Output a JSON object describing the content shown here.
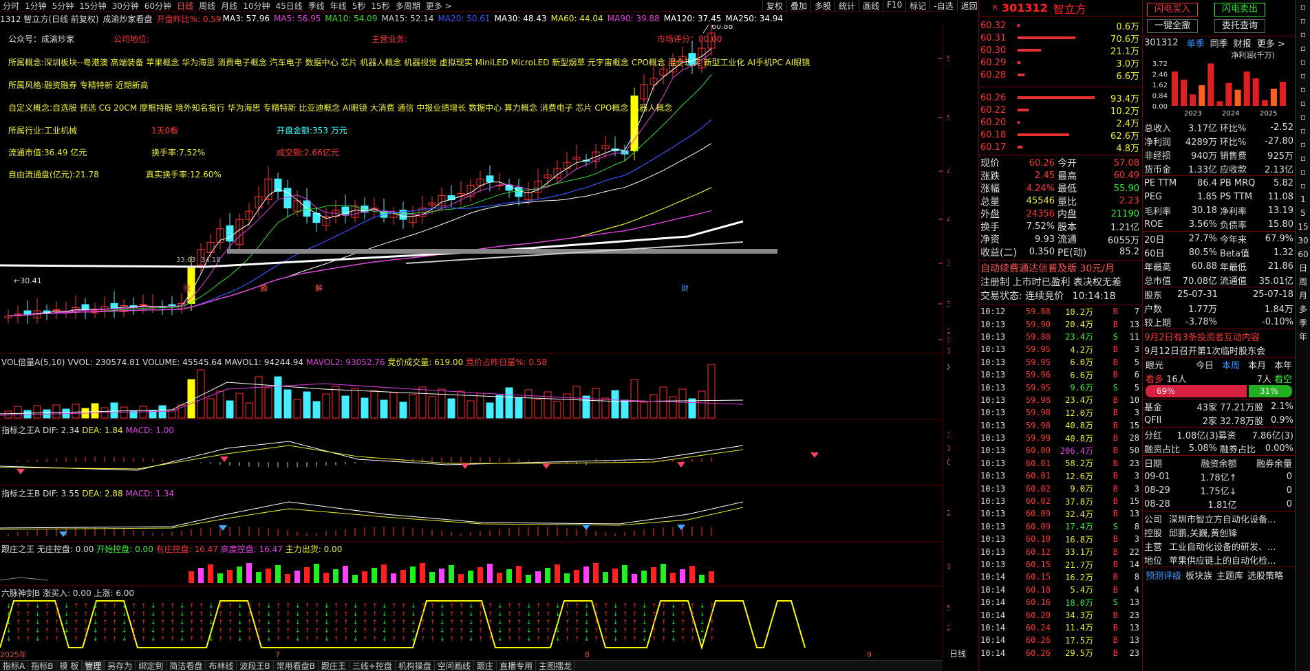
{
  "period_tabs": [
    "分时",
    "1分钟",
    "5分钟",
    "15分钟",
    "30分钟",
    "60分钟",
    "日线",
    "周线",
    "月线",
    "10分钟",
    "45日线",
    "季线",
    "年线",
    "5秒",
    "15秒",
    "多周期",
    "更多 >"
  ],
  "period_selected": "日线",
  "toolbar": [
    "复权",
    "叠加",
    "多股",
    "统计",
    "画线",
    "F10",
    "标记",
    "-自选",
    "返回"
  ],
  "ma_bar": {
    "title": "1312 智立方(日线 前复权)",
    "indicator": "成渝炒家看盘",
    "open_pct_label": "开盘昨比%:",
    "open_pct": "0.59",
    "ma": [
      {
        "label": "MA3: 57.96",
        "color": "#ffffff"
      },
      {
        "label": "MA5: 56.95",
        "color": "#e040e0"
      },
      {
        "label": "MA10: 54.09",
        "color": "#33dd33"
      },
      {
        "label": "MA15: 52.14",
        "color": "#cccccc"
      },
      {
        "label": "MA20: 50.61",
        "color": "#3355ff"
      },
      {
        "label": "MA30: 48.43",
        "color": "#ffffff"
      },
      {
        "label": "MA60: 44.04",
        "color": "#eeee33"
      },
      {
        "label": "MA90: 39.88",
        "color": "#e040e0"
      },
      {
        "label": "MA120: 37.45",
        "color": "#ffffff"
      },
      {
        "label": "MA250: 34.94",
        "color": "#ffffff"
      }
    ]
  },
  "info": {
    "gongzhonghao": "公众号：成渝炒家",
    "company_pos": "公司地位:",
    "main_biz": "主营业务:",
    "market_score": "市场评分：80.00",
    "concepts": "所属概念:深圳板块--粤港澳 高端装备 苹果概念 华为海思 消费电子概念 汽车电子 数据中心 芯片 机器人概念 机器视觉 虚拟现实 MiniLED MicroLED 新型烟草 元宇宙概念 CPO概念 混合现实 新型工业化 AI手机PC AI眼镜",
    "styles": "所属风格:融资融券 专精特新 近期新高",
    "custom": "自定义概念:自选股 预选 CG 20CM 摩根持股 境外知名投行 华为海思 专精特新 比亚迪概念 AI眼镜 大消费 通信 中报业绩增长 数据中心 算力概念 消费电子 芯片 CPO概念 机器人概念",
    "industry": "所属行业:工业机械",
    "board": "1天0板",
    "open_amount": "开盘金额:353 万元",
    "float_cap": "流通市值:36.49 亿元",
    "turnover": "换手率:7.52%",
    "volume_amt": "成交额:2.66亿元",
    "free_float": "自由流通盘(亿元):21.78",
    "real_turnover": "真实换手率:12.60%"
  },
  "kline": {
    "y_ticks": [
      "57.81",
      "52.03",
      "46.83",
      "42.14",
      "37.93",
      "34.14",
      "30.72"
    ],
    "high_label": "60.88",
    "low_label": "30.41",
    "mid_label": "33.63",
    "mid_label2": "34.18",
    "markers": [
      "涨",
      "腾",
      "解",
      "财"
    ],
    "months": [
      "2025年",
      "7",
      "8",
      "9"
    ]
  },
  "vol_panel": {
    "title": "VOL倍量A(5,10)",
    "vvol": "VVOL: 230574.81",
    "volume": "VOLUME: 45545.64",
    "mavol1": "MAVOL1: 94244.94",
    "mavol2": "MAVOL2: 93052.76",
    "bid_vol": "竞价成交量: 619.00",
    "bid_ratio": "竞价占昨日量%: 0.58",
    "y_ticks": [
      "20000",
      "10000",
      "X10"
    ]
  },
  "macd_a": {
    "title": "指标之王A",
    "dif": "DIF: 2.34",
    "dea": "DEA: 1.84",
    "macd": "MACD: 1.00",
    "y_ticks": [
      "3.00",
      "1.50",
      "0.00"
    ]
  },
  "macd_b": {
    "title": "指标之王B",
    "dif": "DIF: 3.55",
    "dea": "DEA: 2.88",
    "macd": "MACD: 1.34",
    "y_ticks": [
      "2.00"
    ]
  },
  "zhuang": {
    "title": "跟庄之王",
    "wz": "无庄控盘: 0.00",
    "ks": "开始控盘: 0.00",
    "yz": "有庄控盘: 16.47",
    "gd": "高度控盘: 16.47",
    "zl": "主力出货: 0.00",
    "y_ticks": [
      "15.00"
    ]
  },
  "liumai": {
    "title": "六脉神剑B",
    "buy": "涨买入: 0.00",
    "up": "上涨: 6.00",
    "y_ticks": [
      "5.00",
      "2.50"
    ]
  },
  "bottom_tabs": [
    "指标A",
    "指标B",
    "模 板",
    "管理",
    "另存为",
    "绑定到",
    "简洁看盘",
    "布林线",
    "波段王B",
    "常用看盘B",
    "跟庄王",
    "三线+控盘",
    "机构操盘",
    "空间画线",
    "跟庄",
    "直播专用",
    "主图擂龙"
  ],
  "bottom_selected": "管理",
  "bottom_right": "日线",
  "stock": {
    "code": "301312",
    "name": "智立方",
    "r_mark": "R"
  },
  "asks": [
    {
      "p": "60.32",
      "v": "0.6万",
      "w": 0.02
    },
    {
      "p": "60.31",
      "v": "70.6万",
      "w": 0.75
    },
    {
      "p": "60.30",
      "v": "21.1万",
      "w": 0.3
    },
    {
      "p": "60.29",
      "v": "3.0万",
      "w": 0.04
    },
    {
      "p": "60.28",
      "v": "6.6万",
      "w": 0.09
    }
  ],
  "bids": [
    {
      "p": "60.26",
      "v": "93.4万",
      "w": 1.0
    },
    {
      "p": "60.22",
      "v": "10.2万",
      "w": 0.14
    },
    {
      "p": "60.20",
      "v": "2.4万",
      "w": 0.03
    },
    {
      "p": "60.18",
      "v": "62.6万",
      "w": 0.67
    },
    {
      "p": "60.17",
      "v": "4.8万",
      "w": 0.06
    }
  ],
  "quote": [
    {
      "l1": "现价",
      "v1": "60.26",
      "c1": "#ff3333",
      "l2": "今开",
      "v2": "57.08",
      "c2": "#ff3333"
    },
    {
      "l1": "涨跌",
      "v1": "2.45",
      "c1": "#ff3333",
      "l2": "最高",
      "v2": "60.49",
      "c2": "#ff3333"
    },
    {
      "l1": "涨幅",
      "v1": "4.24%",
      "c1": "#ff3333",
      "l2": "最低",
      "v2": "55.90",
      "c2": "#33ee33"
    },
    {
      "l1": "总量",
      "v1": "45546",
      "c1": "#eeee33",
      "l2": "量比",
      "v2": "2.23",
      "c2": "#ff3333"
    },
    {
      "l1": "外盘",
      "v1": "24356",
      "c1": "#ff3333",
      "l2": "内盘",
      "v2": "21190",
      "c2": "#33ee33"
    },
    {
      "l1": "换手",
      "v1": "7.52%",
      "c1": "#dddddd",
      "l2": "股本",
      "v2": "1.21亿",
      "c2": "#dddddd"
    },
    {
      "l1": "净资",
      "v1": "9.93",
      "c1": "#dddddd",
      "l2": "流通",
      "v2": "6055万",
      "c2": "#dddddd"
    },
    {
      "l1": "收益(二)",
      "v1": "0.350",
      "c1": "#dddddd",
      "l2": "PE(动)",
      "v2": "85.2",
      "c2": "#dddddd"
    }
  ],
  "notice": {
    "line1": "自动续费通达信普及版  30元/月",
    "line2": "注册制 上市时已盈利 表决权无差",
    "line3": "交易状态: 连续竞价",
    "time": "10:14:18"
  },
  "ticks": [
    {
      "t": "10:12",
      "p": "59.88",
      "v": "10.2万",
      "s": "B",
      "n": "7"
    },
    {
      "t": "10:13",
      "p": "59.90",
      "v": "20.4万",
      "s": "B",
      "n": "13"
    },
    {
      "t": "10:13",
      "p": "59.88",
      "v": "23.4万",
      "s": "S",
      "n": "11"
    },
    {
      "t": "10:13",
      "p": "59.95",
      "v": "4.2万",
      "s": "B",
      "n": "3"
    },
    {
      "t": "10:13",
      "p": "59.95",
      "v": "6.0万",
      "s": "B",
      "n": "5"
    },
    {
      "t": "10:13",
      "p": "59.96",
      "v": "6.6万",
      "s": "B",
      "n": "6"
    },
    {
      "t": "10:13",
      "p": "59.95",
      "v": "9.6万",
      "s": "S",
      "n": "5"
    },
    {
      "t": "10:13",
      "p": "59.98",
      "v": "23.4万",
      "s": "B",
      "n": "10"
    },
    {
      "t": "10:13",
      "p": "59.98",
      "v": "12.0万",
      "s": "B",
      "n": "3"
    },
    {
      "t": "10:13",
      "p": "59.98",
      "v": "40.8万",
      "s": "B",
      "n": "15"
    },
    {
      "t": "10:13",
      "p": "59.99",
      "v": "40.8万",
      "s": "B",
      "n": "28"
    },
    {
      "t": "10:13",
      "p": "60.00",
      "v": "206.4万",
      "s": "B",
      "n": "50"
    },
    {
      "t": "10:13",
      "p": "60.01",
      "v": "58.2万",
      "s": "B",
      "n": "23"
    },
    {
      "t": "10:13",
      "p": "60.01",
      "v": "12.6万",
      "s": "B",
      "n": "3"
    },
    {
      "t": "10:13",
      "p": "60.02",
      "v": "9.0万",
      "s": "B",
      "n": "3"
    },
    {
      "t": "10:13",
      "p": "60.02",
      "v": "37.8万",
      "s": "B",
      "n": "15"
    },
    {
      "t": "10:13",
      "p": "60.09",
      "v": "32.4万",
      "s": "B",
      "n": "13"
    },
    {
      "t": "10:13",
      "p": "60.09",
      "v": "17.4万",
      "s": "S",
      "n": "8"
    },
    {
      "t": "10:13",
      "p": "60.10",
      "v": "16.8万",
      "s": "B",
      "n": "3"
    },
    {
      "t": "10:13",
      "p": "60.12",
      "v": "33.1万",
      "s": "B",
      "n": "22"
    },
    {
      "t": "10:13",
      "p": "60.15",
      "v": "21.7万",
      "s": "B",
      "n": "14"
    },
    {
      "t": "10:14",
      "p": "60.15",
      "v": "16.2万",
      "s": "B",
      "n": "8"
    },
    {
      "t": "10:14",
      "p": "60.18",
      "v": "5.4万",
      "s": "B",
      "n": "4"
    },
    {
      "t": "10:14",
      "p": "60.16",
      "v": "18.0万",
      "s": "S",
      "n": "13"
    },
    {
      "t": "10:14",
      "p": "60.20",
      "v": "34.3万",
      "s": "B",
      "n": "23"
    },
    {
      "t": "10:14",
      "p": "60.24",
      "v": "11.4万",
      "s": "B",
      "n": "13"
    },
    {
      "t": "10:14",
      "p": "60.26",
      "v": "17.5万",
      "s": "B",
      "n": "13"
    },
    {
      "t": "10:14",
      "p": "60.26",
      "v": "29.5万",
      "s": "B",
      "n": "23"
    }
  ],
  "far": {
    "btn_sell": "闪电买入",
    "btn_buy": "闪电卖出",
    "btn_all": "一键全撤",
    "btn_query": "委托查询",
    "code": "301312",
    "tabs": [
      "单季",
      "同季",
      "财报",
      "更多 >"
    ],
    "chart_title": "净利润(千万)",
    "chart_data": {
      "type": "bar",
      "ylabels": [
        "3.72",
        "2.46",
        "1.62",
        "0.84",
        "0.00"
      ],
      "xlabels": [
        "2023",
        "2024",
        "2025"
      ],
      "values": [
        3.0,
        2.3,
        1.0,
        1.8,
        3.7,
        0.4,
        2.0,
        1.4,
        3.0,
        2.4,
        0.5,
        1.5,
        2.1
      ],
      "highlight": [
        3,
        7,
        11
      ]
    },
    "fin": [
      {
        "a": "总收入",
        "b": "3.17亿",
        "c": "环比%",
        "d": "-2.52"
      },
      {
        "a": "净利润",
        "b": "4289万",
        "c": "环比%",
        "d": "-27.80"
      },
      {
        "a": "非经损",
        "b": "940万",
        "c": "销售费",
        "d": "925万"
      },
      {
        "a": "货币金",
        "b": "1.33亿",
        "c": "应收款",
        "d": "2.13亿"
      }
    ],
    "val": [
      {
        "a": "PE TTM",
        "b": "86.4",
        "c": "PB MRQ",
        "d": "5.82"
      },
      {
        "a": "PEG",
        "b": "1.85",
        "c": "PS TTM",
        "d": "11.08"
      },
      {
        "a": "毛利率",
        "b": "30.18",
        "c": "净利率",
        "d": "13.19"
      },
      {
        "a": "ROE",
        "b": "3.56%",
        "c": "负债率",
        "d": "15.80"
      }
    ],
    "perf": [
      {
        "a": "20日",
        "b": "27.7%",
        "c": "今年来",
        "d": "67.9%"
      },
      {
        "a": "60日",
        "b": "80.5%",
        "c": "Beta值",
        "d": "1.32"
      },
      {
        "a": "年最高",
        "b": "60.88",
        "c": "年最低",
        "d": "21.86"
      },
      {
        "a": "总市值",
        "b": "70.08亿",
        "c": "流通值",
        "d": "35.01亿"
      }
    ],
    "holders": [
      {
        "a": "股东",
        "b": "25-07-31",
        "c": "",
        "d": "25-07-18"
      },
      {
        "a": "户数",
        "b": "1.77万",
        "c": "",
        "d": "1.84万"
      },
      {
        "a": "较上期",
        "b": "-3.78%",
        "c": "",
        "d": "-0.10%"
      }
    ],
    "events": [
      "9月2日有3条投资者互动内容",
      "9月12日召开第1次临时股东会"
    ],
    "eye": {
      "title": "眼光",
      "tabs": [
        "今日",
        "本周",
        "本月",
        "本年"
      ],
      "bull": "看多",
      "bull_n": "16人",
      "bear_n": "7人",
      "bear": "看空",
      "bull_pct": "69%",
      "bear_pct": "31%",
      "bull_frac": 0.69
    },
    "inst": [
      {
        "a": "基金",
        "b": "43家",
        "c": "77.21万股",
        "d": "2.1%"
      },
      {
        "a": "QFII",
        "b": "2家",
        "c": "32.78万股",
        "d": "0.9%"
      }
    ],
    "div": [
      {
        "a": "分红",
        "b": "1.08亿(3)",
        "c": "募资",
        "d": "7.86亿(3)"
      },
      {
        "a": "融资占比",
        "b": "5.08%",
        "c": "融券占比",
        "d": "0.00%"
      }
    ],
    "margin_head": [
      "日期",
      "融资余额",
      "融券余量"
    ],
    "margin": [
      {
        "d": "09-01",
        "a": "1.78亿↑",
        "b": "0"
      },
      {
        "d": "08-29",
        "a": "1.75亿↓",
        "b": "0"
      },
      {
        "d": "08-28",
        "a": "1.81亿",
        "b": "0"
      }
    ],
    "comp": [
      {
        "a": "公司",
        "b": "深圳市智立方自动化设备..."
      },
      {
        "a": "控股",
        "b": "邱鹏,关巍,黄创锋"
      },
      {
        "a": "主营",
        "b": "工业自动化设备的研发、..."
      },
      {
        "a": "地位",
        "b": "苹果供应链上的自动化检..."
      }
    ],
    "links": [
      "预测评级",
      "板块族",
      "主题库",
      "选股策略"
    ],
    "side": [
      "1",
      "5",
      "15",
      "30",
      "60",
      "日",
      "周",
      "月",
      "多",
      "季",
      "年"
    ]
  }
}
